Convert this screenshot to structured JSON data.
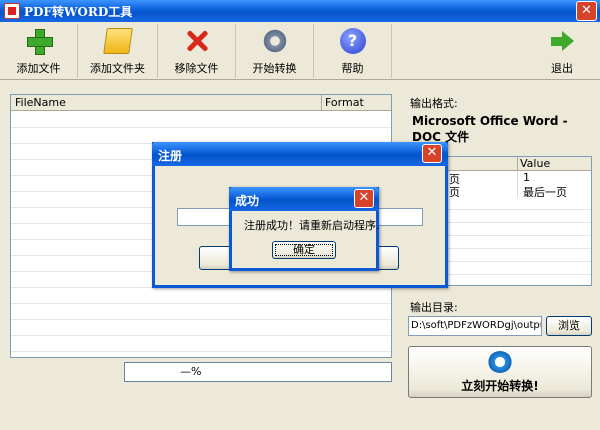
{
  "window": {
    "title": "PDF转WORD工具",
    "close": "✕"
  },
  "toolbar": {
    "add_file": "添加文件",
    "add_folder": "添加文件夹",
    "remove_file": "移除文件",
    "start_convert": "开始转换",
    "help": "帮助",
    "help_glyph": "?",
    "exit": "退出"
  },
  "file_list": {
    "columns": [
      "FileName",
      "Format"
    ]
  },
  "progress": {
    "value": 0,
    "text": "—%"
  },
  "output": {
    "format_label": "输出格式:",
    "format_value": "Microsoft Office Word - DOC 文件",
    "props_header_value": "Value",
    "props": [
      {
        "name": "页",
        "value": "1"
      },
      {
        "name": "页",
        "value": "最后一页"
      }
    ],
    "dir_label": "输出目录:",
    "dir_value": "D:\\soft\\PDFzWORDgj\\output\\",
    "browse": "浏览",
    "convert_now": "立刻开始转换!"
  },
  "register_dialog": {
    "title": "注册",
    "close": "✕"
  },
  "success_dialog": {
    "title": "成功",
    "close": "✕",
    "message": "注册成功！请重新启动程序.",
    "ok": "确定"
  },
  "colors": {
    "titlebar": "#0a5fd8",
    "close": "#d7422a",
    "dialog_bg": "#ece9d8"
  }
}
